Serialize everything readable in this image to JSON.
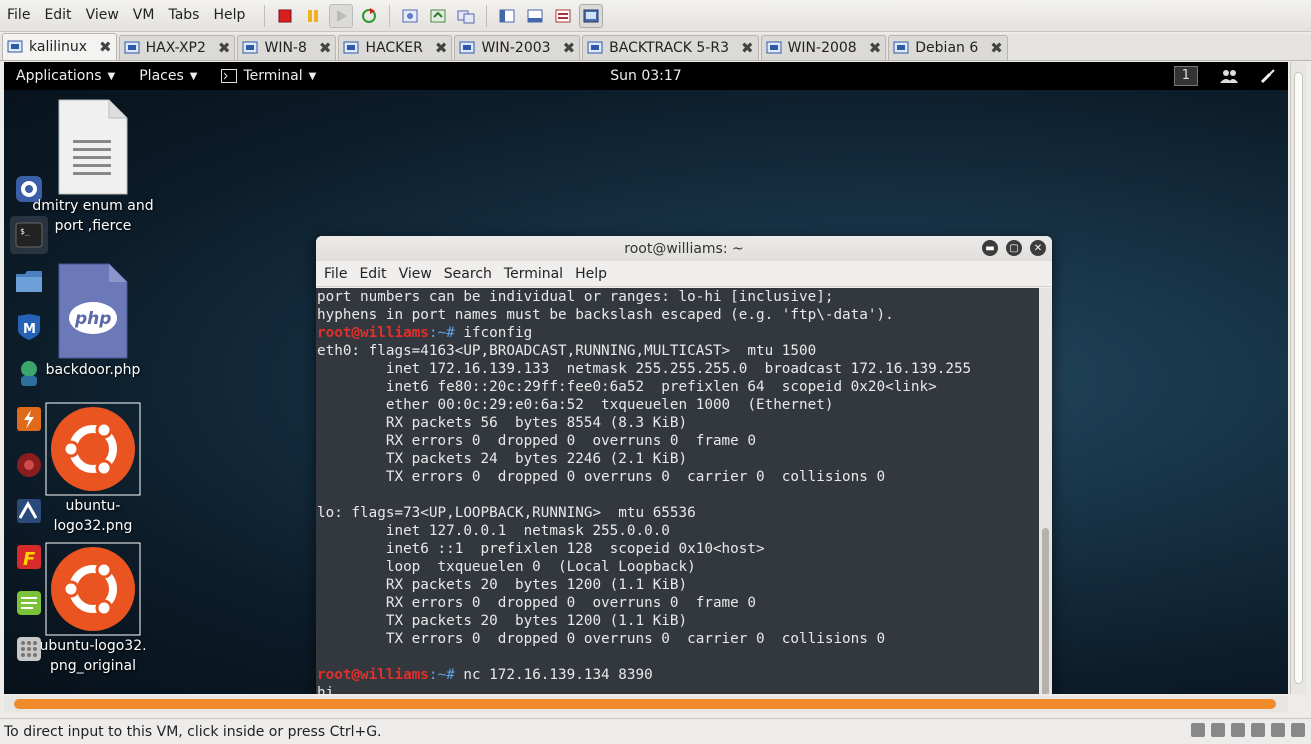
{
  "host": {
    "menu": [
      "File",
      "Edit",
      "View",
      "VM",
      "Tabs",
      "Help"
    ],
    "tabs": [
      {
        "label": "kalilinux",
        "active": true
      },
      {
        "label": "HAX-XP2",
        "active": false
      },
      {
        "label": "WIN-8",
        "active": false
      },
      {
        "label": "HACKER",
        "active": false
      },
      {
        "label": "WIN-2003",
        "active": false
      },
      {
        "label": "BACKTRACK 5-R3",
        "active": false
      },
      {
        "label": "WIN-2008",
        "active": false
      },
      {
        "label": "Debian 6",
        "active": false
      }
    ],
    "status_text": "To direct input to this VM, click inside or press Ctrl+G."
  },
  "gnome": {
    "applications": "Applications",
    "places": "Places",
    "terminal": "Terminal",
    "clock": "Sun 03:17",
    "workspace": "1"
  },
  "desktop_icons": [
    {
      "label_line1": "dmitry enum and",
      "label_line2": "port ,fierce"
    },
    {
      "label_line1": "backdoor.php",
      "label_line2": ""
    },
    {
      "label_line1": "ubuntu-logo32.png",
      "label_line2": ""
    },
    {
      "label_line1": "ubuntu-logo32.",
      "label_line2": "png_original"
    }
  ],
  "terminal": {
    "title": "root@williams: ~",
    "menu": [
      "File",
      "Edit",
      "View",
      "Search",
      "Terminal",
      "Help"
    ],
    "prompt_user": "root@williams",
    "prompt_path": ":~#",
    "lines": [
      "port numbers can be individual or ranges: lo-hi [inclusive];",
      "hyphens in port names must be backslash escaped (e.g. 'ftp\\-data').",
      "",
      "eth0: flags=4163<UP,BROADCAST,RUNNING,MULTICAST>  mtu 1500",
      "        inet 172.16.139.133  netmask 255.255.255.0  broadcast 172.16.139.255",
      "        inet6 fe80::20c:29ff:fee0:6a52  prefixlen 64  scopeid 0x20<link>",
      "        ether 00:0c:29:e0:6a:52  txqueuelen 1000  (Ethernet)",
      "        RX packets 56  bytes 8554 (8.3 KiB)",
      "        RX errors 0  dropped 0  overruns 0  frame 0",
      "        TX packets 24  bytes 2246 (2.1 KiB)",
      "        TX errors 0  dropped 0 overruns 0  carrier 0  collisions 0",
      "",
      "lo: flags=73<UP,LOOPBACK,RUNNING>  mtu 65536",
      "        inet 127.0.0.1  netmask 255.0.0.0",
      "        inet6 ::1  prefixlen 128  scopeid 0x10<host>",
      "        loop  txqueuelen 0  (Local Loopback)",
      "        RX packets 20  bytes 1200 (1.1 KiB)",
      "        RX errors 0  dropped 0  overruns 0  frame 0",
      "        TX packets 20  bytes 1200 (1.1 KiB)",
      "        TX errors 0  dropped 0 overruns 0  carrier 0  collisions 0",
      "",
      "",
      "hi"
    ],
    "cmd1": " ifconfig",
    "cmd2": " nc 172.16.139.134 8390"
  }
}
